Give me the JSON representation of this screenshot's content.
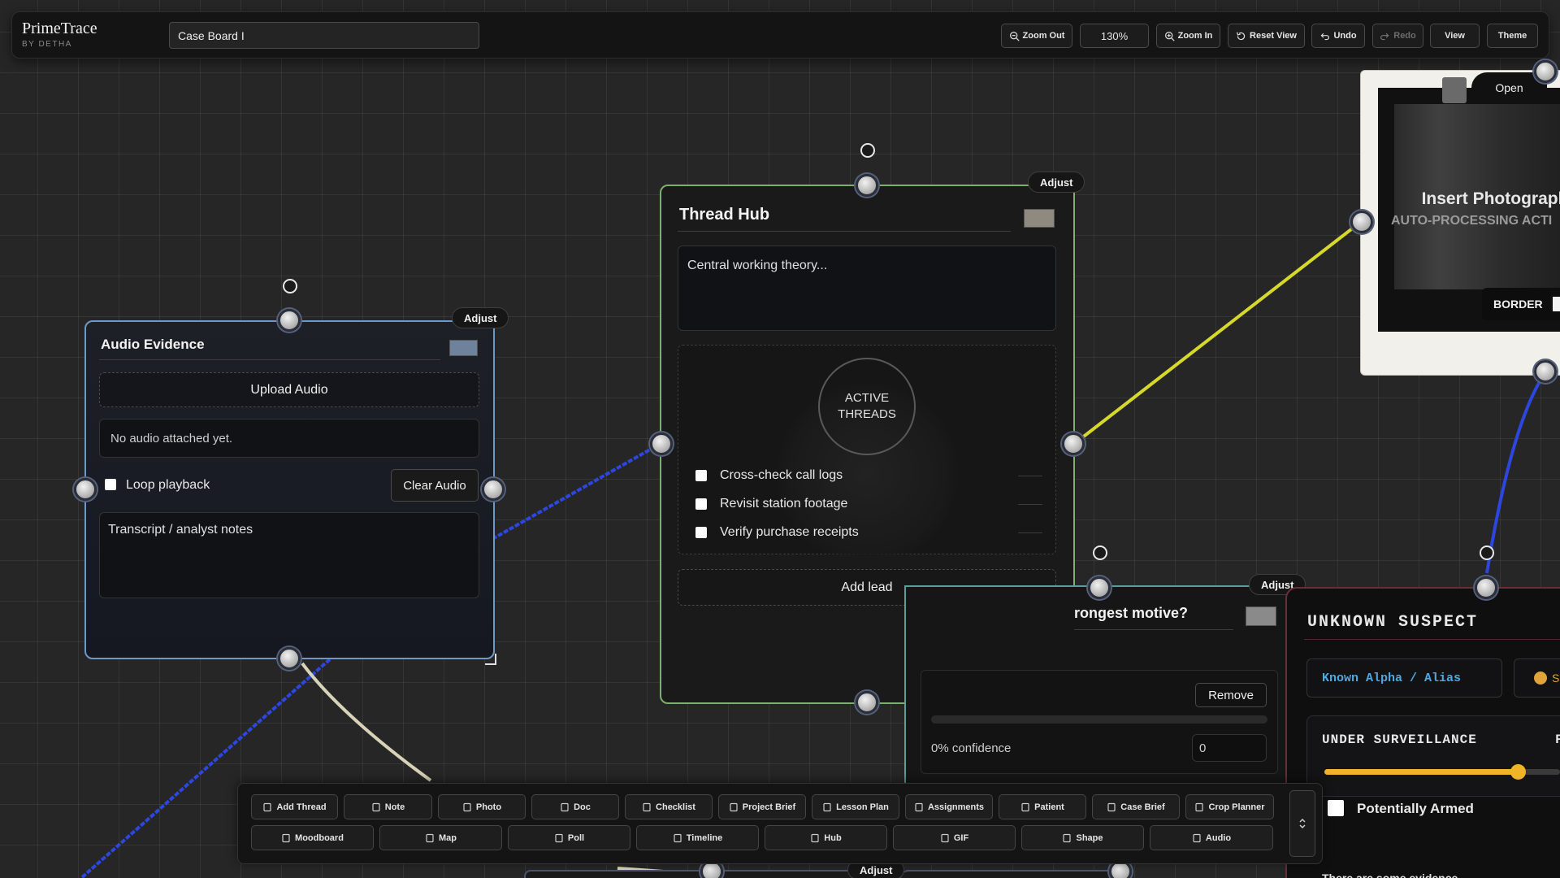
{
  "app": {
    "name": "PrimeTrace",
    "sub": "BY DETHA"
  },
  "board": {
    "title": "Case Board I"
  },
  "toolbar_top": {
    "zoom_out": "Zoom Out",
    "zoom_level": "130%",
    "zoom_in": "Zoom In",
    "reset_view": "Reset View",
    "undo": "Undo",
    "redo": "Redo",
    "view": "View",
    "theme": "Theme"
  },
  "audio_card": {
    "title": "Audio Evidence",
    "adjust": "Adjust",
    "upload": "Upload Audio",
    "status": "No audio attached yet.",
    "loop_label": "Loop playback",
    "clear": "Clear Audio",
    "notes_placeholder": "Transcript / analyst notes",
    "swatch_color": "#6e829c"
  },
  "hub_card": {
    "title": "Thread Hub",
    "adjust": "Adjust",
    "theory_placeholder": "Central working theory...",
    "badge_line1": "ACTIVE",
    "badge_line2": "THREADS",
    "leads": [
      "Cross-check call logs",
      "Revisit station footage",
      "Verify purchase receipts"
    ],
    "add_lead": "Add lead",
    "swatch_color": "#8f8a80"
  },
  "poll_card": {
    "adjust": "Adjust",
    "question": "rongest motive?",
    "remove": "Remove",
    "confidence": "0% confidence",
    "vote_value": "0"
  },
  "photo_card": {
    "open": "Open",
    "title": "Insert Photograph",
    "sub": "AUTO-PROCESSING ACTI",
    "border_label": "BORDER"
  },
  "suspect_card": {
    "title": "UNKNOWN SUSPECT",
    "alias": "Known Alpha / Alias",
    "status_dot_label": "S",
    "surveillance": "UNDER SURVEILLANCE",
    "surveillance_extra": "F",
    "surveillance_level": 0.82,
    "armed": "Potentially Armed",
    "footer": "There are some evidence"
  },
  "bottom_adjust": "Adjust",
  "tools_row1": [
    "Add Thread",
    "Note",
    "Photo",
    "Doc",
    "Checklist",
    "Project Brief",
    "Lesson Plan",
    "Assignments",
    "Patient",
    "Case Brief",
    "Crop Planner"
  ],
  "tools_row2": [
    "Moodboard",
    "Map",
    "Poll",
    "Timeline",
    "Hub",
    "GIF",
    "Shape",
    "Audio"
  ],
  "colors": {
    "link_blue": "#2d46e0",
    "link_yellow": "#d6d92a",
    "link_cream": "#d8d2b8",
    "audio_border": "#6f98c8",
    "hub_border": "#7eaf6c",
    "suspect_border": "#6a2e36",
    "alias_text": "#4fa8e0",
    "slider_fill": "#f0b429"
  }
}
